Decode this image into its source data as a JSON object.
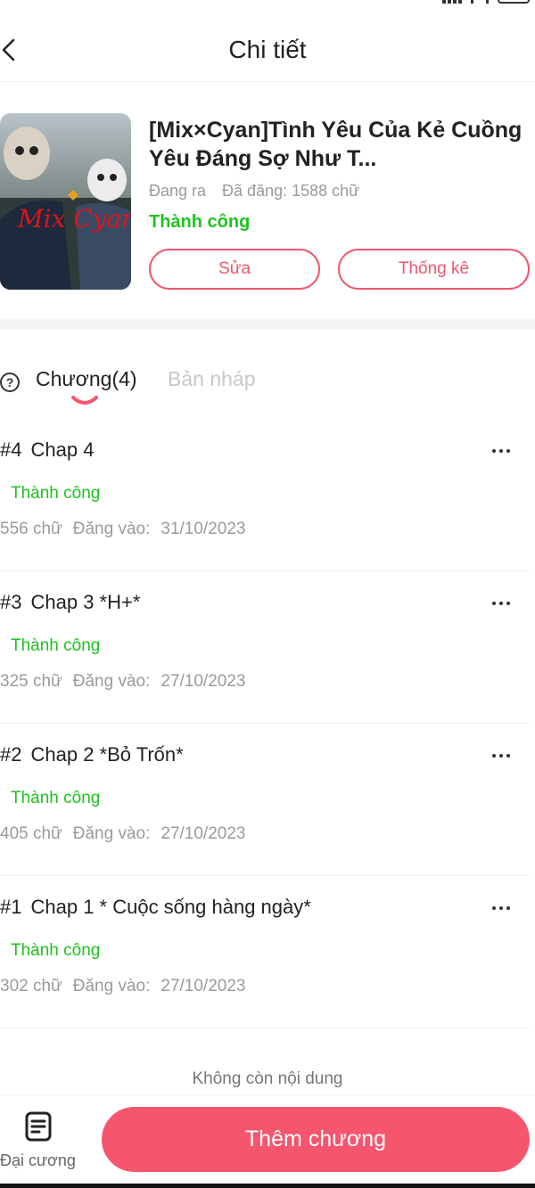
{
  "header": {
    "title": "Chi tiết"
  },
  "story": {
    "title": "[Mix×Cyan]Tình Yêu Của Kẻ Cuồng Yêu Đáng Sợ Như T...",
    "status_ongoing": "Đang ra",
    "words_posted": "Đã đăng: 1588 chữ",
    "publish_status": "Thành công",
    "edit_label": "Sửa",
    "stats_label": "Thống kê",
    "cover_text": "Mix Cyan"
  },
  "tabs": {
    "chapters_label": "Chương(4)",
    "drafts_label": "Bản nháp"
  },
  "chapters": [
    {
      "number": "#4",
      "title": "Chap 4",
      "status": "Thành công",
      "words": "556 chữ",
      "posted_label": "Đăng vào:",
      "date": "31/10/2023"
    },
    {
      "number": "#3",
      "title": "Chap 3 *H+*",
      "status": "Thành công",
      "words": "325 chữ",
      "posted_label": "Đăng vào:",
      "date": "27/10/2023"
    },
    {
      "number": "#2",
      "title": "Chap 2 *Bỏ Trốn*",
      "status": "Thành công",
      "words": "405 chữ",
      "posted_label": "Đăng vào:",
      "date": "27/10/2023"
    },
    {
      "number": "#1",
      "title": "Chap 1 * Cuộc sống hàng ngày*",
      "status": "Thành công",
      "words": "302 chữ",
      "posted_label": "Đăng vào:",
      "date": "27/10/2023"
    }
  ],
  "footer": {
    "no_more": "Không còn nội dung",
    "outline_label": "Đại cương",
    "add_chapter": "Thêm chương"
  },
  "colors": {
    "accent": "#f5566e",
    "success": "#1fc21f",
    "muted": "#9a9a9a"
  }
}
